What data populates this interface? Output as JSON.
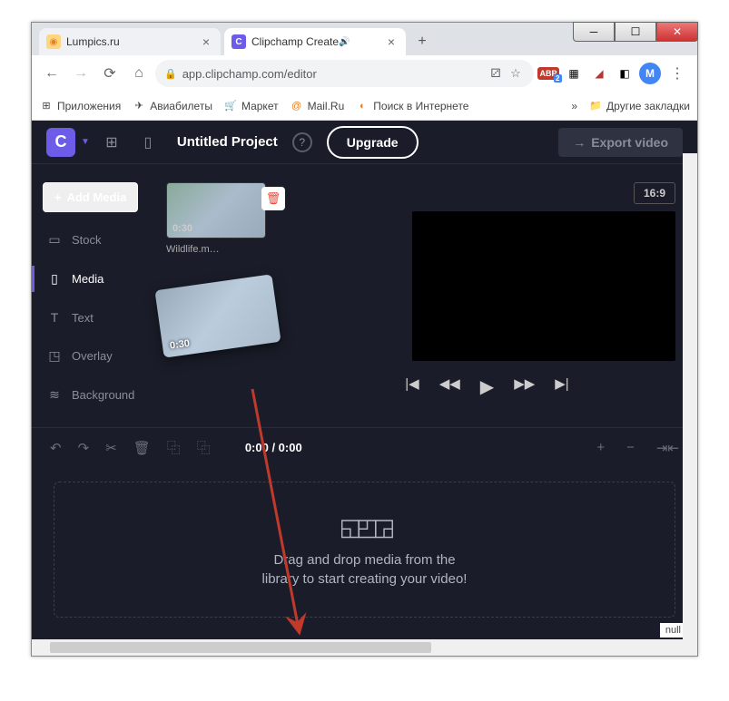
{
  "tabs": [
    {
      "title": "Lumpics.ru",
      "active": false
    },
    {
      "title": "Clipchamp Create",
      "active": true
    }
  ],
  "url": "app.clipchamp.com/editor",
  "ext_abp_badge": "2",
  "avatar_letter": "M",
  "bookmarks": {
    "apps": "Приложения",
    "avia": "Авиабилеты",
    "market": "Маркет",
    "mail": "Mail.Ru",
    "poisk": "Поиск в Интернете",
    "more": "»",
    "other": "Другие закладки"
  },
  "header": {
    "logo": "C",
    "project": "Untitled Project",
    "upgrade": "Upgrade",
    "export": "Export video"
  },
  "sidebar": {
    "add_media": "Add Media",
    "items": [
      {
        "label": "Stock"
      },
      {
        "label": "Media"
      },
      {
        "label": "Text"
      },
      {
        "label": "Overlay"
      },
      {
        "label": "Background"
      }
    ]
  },
  "media": {
    "duration": "0:30",
    "filename": "Wildlife.m…",
    "drag_duration": "0:30"
  },
  "preview": {
    "aspect": "16:9"
  },
  "timeline": {
    "time": "0:00 / 0:00"
  },
  "dropzone": {
    "line1": "Drag and drop media from the",
    "line2": "library to start creating your video!"
  },
  "null_label": "null"
}
